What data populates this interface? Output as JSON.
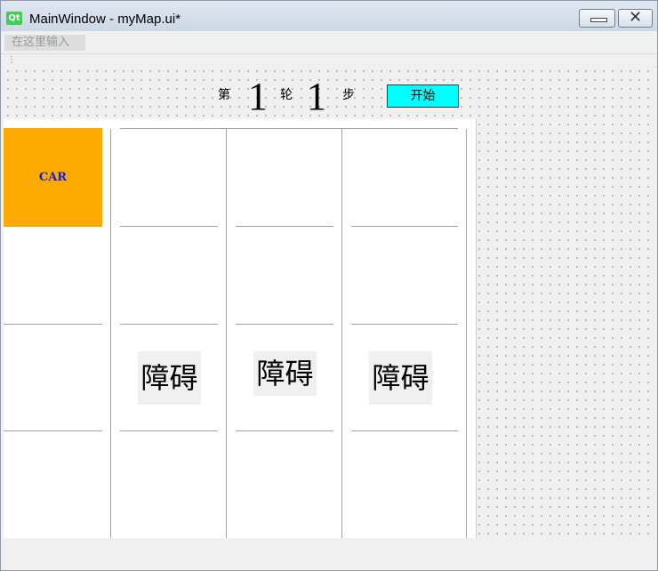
{
  "window": {
    "title": "MainWindow - myMap.ui*",
    "logo_text": "Qt",
    "minimize_icon": "minimize-icon",
    "close_icon": "close-icon"
  },
  "menu": {
    "placeholder_text": "在这里输入"
  },
  "counter": {
    "label_di": "第",
    "round": "1",
    "label_lun": "轮",
    "step": "1",
    "label_bu": "步"
  },
  "start_button": {
    "label": "开始",
    "color": "#00ffff"
  },
  "grid": {
    "car_label": "CAR",
    "car_color": "#ffaa00",
    "obstacles": [
      "障碍",
      "障碍",
      "障碍"
    ]
  }
}
